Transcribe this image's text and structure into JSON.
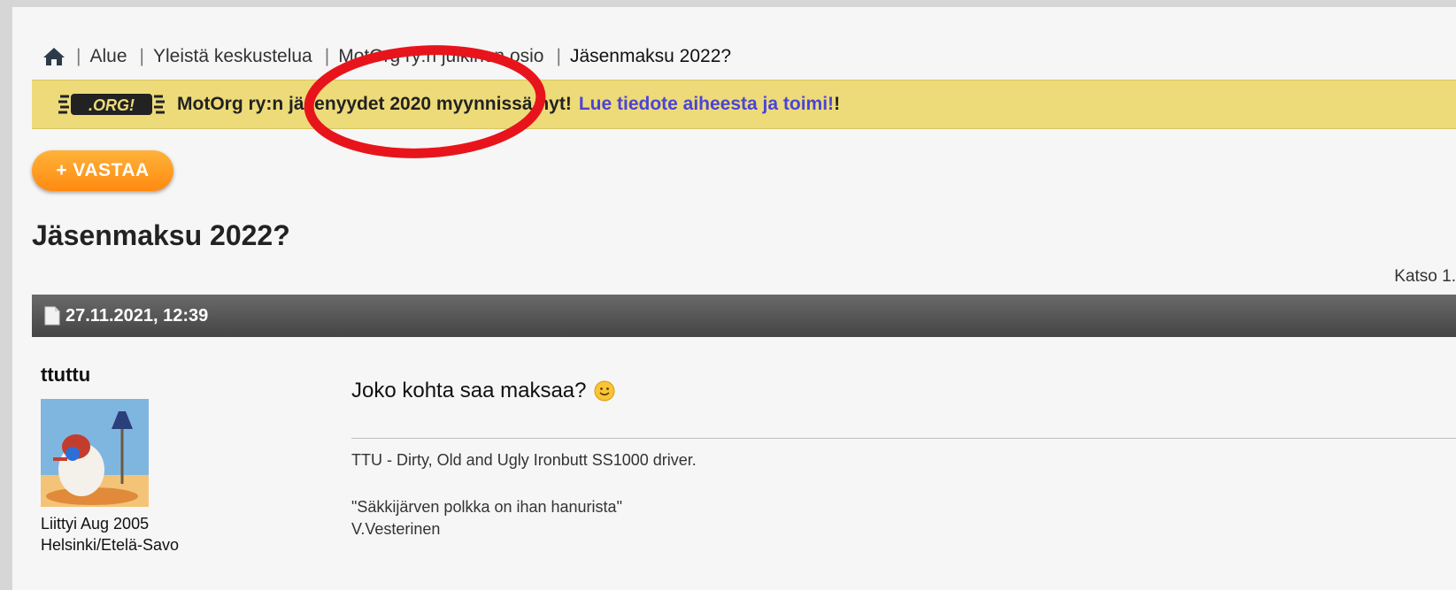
{
  "breadcrumb": {
    "items": [
      "Alue",
      "Yleistä keskustelua",
      "MotOrg ry:n julkinen osio"
    ],
    "current": "Jäsenmaksu 2022?"
  },
  "notice": {
    "logo_text": ".ORG!",
    "text": "MotOrg ry:n jäsenyydet 2020 myynnissä nyt!",
    "link_text": "Lue tiedote aiheesta ja toimi!",
    "suffix": "!"
  },
  "reply_button": {
    "label": "+ VASTAA"
  },
  "thread": {
    "title": "Jäsenmaksu 2022?",
    "view_count": "Katso 1."
  },
  "post": {
    "date": "27.11.2021, 12:39",
    "author": {
      "name": "ttuttu",
      "joined": "Liittyi Aug 2005",
      "location": "Helsinki/Etelä-Savo"
    },
    "body": "Joko kohta saa maksaa?",
    "signature": [
      "TTU - Dirty, Old and Ugly Ironbutt SS1000 driver.",
      "\"Säkkijärven polkka on ihan hanurista\"",
      "V.Vesterinen"
    ]
  },
  "colors": {
    "notice_bg": "#eddb79",
    "link": "#4a44d6",
    "reply_orange": "#ff8a10",
    "annotation_red": "#e8141c"
  },
  "icons": [
    "home-icon",
    "org-logo",
    "document-icon",
    "smiley-icon"
  ]
}
